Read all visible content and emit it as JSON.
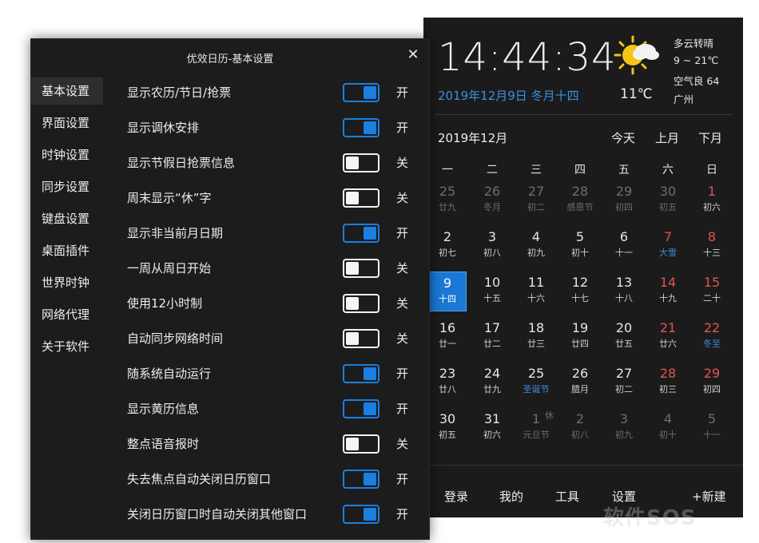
{
  "calendar": {
    "time": "14:44:34",
    "date_line": "2019年12月9日 冬月十四",
    "temperature": "11℃",
    "weather": {
      "desc": "多云转晴",
      "range": "9 ~ 21℃",
      "air": "空气良 64",
      "city": "广州",
      "icon": "partly-cloudy-icon"
    },
    "month_title": "2019年12月",
    "nav": {
      "today": "今天",
      "prev": "上月",
      "next": "下月"
    },
    "weekdays": [
      "一",
      "二",
      "三",
      "四",
      "五",
      "六",
      "日"
    ],
    "rows": [
      [
        {
          "d": "25",
          "l": "廿九",
          "t": "other"
        },
        {
          "d": "26",
          "l": "冬月",
          "t": "other"
        },
        {
          "d": "27",
          "l": "初二",
          "t": "other"
        },
        {
          "d": "28",
          "l": "感恩节",
          "t": "other"
        },
        {
          "d": "29",
          "l": "初四",
          "t": "other"
        },
        {
          "d": "30",
          "l": "初五",
          "t": "other"
        },
        {
          "d": "1",
          "l": "初六",
          "t": "wknd"
        }
      ],
      [
        {
          "d": "2",
          "l": "初七",
          "t": ""
        },
        {
          "d": "3",
          "l": "初八",
          "t": ""
        },
        {
          "d": "4",
          "l": "初九",
          "t": ""
        },
        {
          "d": "5",
          "l": "初十",
          "t": ""
        },
        {
          "d": "6",
          "l": "十一",
          "t": ""
        },
        {
          "d": "7",
          "l": "大雪",
          "t": "wknd",
          "f": true
        },
        {
          "d": "8",
          "l": "十三",
          "t": "wknd"
        }
      ],
      [
        {
          "d": "9",
          "l": "十四",
          "t": "sel"
        },
        {
          "d": "10",
          "l": "十五",
          "t": ""
        },
        {
          "d": "11",
          "l": "十六",
          "t": ""
        },
        {
          "d": "12",
          "l": "十七",
          "t": ""
        },
        {
          "d": "13",
          "l": "十八",
          "t": ""
        },
        {
          "d": "14",
          "l": "十九",
          "t": "wknd"
        },
        {
          "d": "15",
          "l": "二十",
          "t": "wknd"
        }
      ],
      [
        {
          "d": "16",
          "l": "廿一",
          "t": ""
        },
        {
          "d": "17",
          "l": "廿二",
          "t": ""
        },
        {
          "d": "18",
          "l": "廿三",
          "t": ""
        },
        {
          "d": "19",
          "l": "廿四",
          "t": ""
        },
        {
          "d": "20",
          "l": "廿五",
          "t": ""
        },
        {
          "d": "21",
          "l": "廿六",
          "t": "wknd"
        },
        {
          "d": "22",
          "l": "冬至",
          "t": "wknd",
          "f": true
        }
      ],
      [
        {
          "d": "23",
          "l": "廿八",
          "t": ""
        },
        {
          "d": "24",
          "l": "廿九",
          "t": ""
        },
        {
          "d": "25",
          "l": "圣诞节",
          "t": "",
          "f": true
        },
        {
          "d": "26",
          "l": "腊月",
          "t": ""
        },
        {
          "d": "27",
          "l": "初二",
          "t": ""
        },
        {
          "d": "28",
          "l": "初三",
          "t": "wknd"
        },
        {
          "d": "29",
          "l": "初四",
          "t": "wknd"
        }
      ],
      [
        {
          "d": "30",
          "l": "初五",
          "t": ""
        },
        {
          "d": "31",
          "l": "初六",
          "t": ""
        },
        {
          "d": "1",
          "l": "元旦节",
          "t": "other",
          "r": "休"
        },
        {
          "d": "2",
          "l": "初八",
          "t": "other"
        },
        {
          "d": "3",
          "l": "初九",
          "t": "other"
        },
        {
          "d": "4",
          "l": "初十",
          "t": "other"
        },
        {
          "d": "5",
          "l": "十一",
          "t": "other"
        }
      ]
    ],
    "footer": {
      "login": "登录",
      "mine": "我的",
      "tools": "工具",
      "settings": "设置",
      "new": "+新建"
    },
    "watermark": "软件SOS"
  },
  "settings": {
    "title": "优效日历-基本设置",
    "sidebar": [
      "基本设置",
      "界面设置",
      "时钟设置",
      "同步设置",
      "键盘设置",
      "桌面插件",
      "世界时钟",
      "网络代理",
      "关于软件"
    ],
    "on_label": "开",
    "off_label": "关",
    "options": [
      {
        "label": "显示农历/节日/抢票",
        "on": true
      },
      {
        "label": "显示调休安排",
        "on": true
      },
      {
        "label": "显示节假日抢票信息",
        "on": false
      },
      {
        "label": "周末显示“休”字",
        "on": false
      },
      {
        "label": "显示非当前月日期",
        "on": true
      },
      {
        "label": "一周从周日开始",
        "on": false
      },
      {
        "label": "使用12小时制",
        "on": false
      },
      {
        "label": "自动同步网络时间",
        "on": false
      },
      {
        "label": "随系统自动运行",
        "on": true
      },
      {
        "label": "显示黄历信息",
        "on": true
      },
      {
        "label": "整点语音报时",
        "on": false
      },
      {
        "label": "失去焦点自动关闭日历窗口",
        "on": true
      },
      {
        "label": "关闭日历窗口时自动关闭其他窗口",
        "on": true
      }
    ]
  }
}
